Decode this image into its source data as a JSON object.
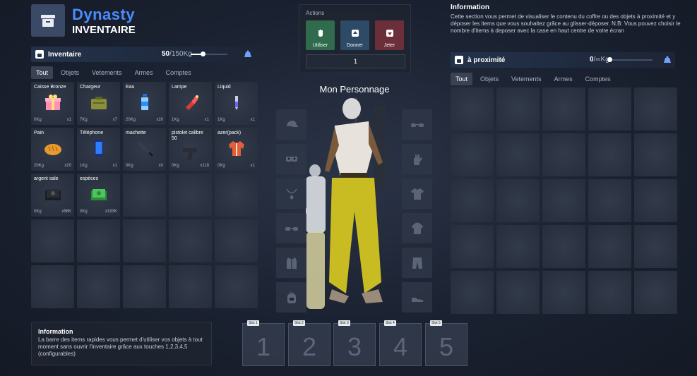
{
  "header": {
    "brand": "Dynasty",
    "subtitle": "INVENTAIRE",
    "logo_icon": "box-icon"
  },
  "inventory": {
    "title": "Inventaire",
    "weight_current": "50",
    "weight_max": "/150Kg",
    "weight_fraction": 0.33,
    "tabs": [
      "Tout",
      "Objets",
      "Vetements",
      "Armes",
      "Comptes"
    ],
    "active_tab": "Tout",
    "items": [
      {
        "name": "Caisse Bronze",
        "weight": "0Kg",
        "qty": "x1",
        "icon": "gift-icon"
      },
      {
        "name": "Chargeur",
        "weight": "7Kg",
        "qty": "x7",
        "icon": "ammo-box-icon"
      },
      {
        "name": "Eau",
        "weight": "20Kg",
        "qty": "x20",
        "icon": "water-bottle-icon"
      },
      {
        "name": "Lampe",
        "weight": "1Kg",
        "qty": "x1",
        "icon": "flashlight-icon"
      },
      {
        "name": "Liquid",
        "weight": "1Kg",
        "qty": "x1",
        "icon": "vial-icon"
      },
      {
        "name": "Pain",
        "weight": "20Kg",
        "qty": "x20",
        "icon": "bread-icon"
      },
      {
        "name": "Téléphone",
        "weight": "1Kg",
        "qty": "x1",
        "icon": "phone-icon"
      },
      {
        "name": "machette",
        "weight": "0Kg",
        "qty": "x0",
        "icon": "machete-icon"
      },
      {
        "name": "pistolet calibre 50",
        "weight": "0Kg",
        "qty": "x118",
        "icon": "pistol-icon"
      },
      {
        "name": "azer(pack)",
        "weight": "0Kg",
        "qty": "x1",
        "icon": "jacket-icon"
      },
      {
        "name": "argent sale",
        "weight": "0Kg",
        "qty": "x56K",
        "icon": "dirty-money-icon"
      },
      {
        "name": "espèces",
        "weight": "0Kg",
        "qty": "x193K",
        "icon": "cash-icon"
      }
    ]
  },
  "actions": {
    "label": "Actions",
    "use": "Utiliser",
    "give": "Donner",
    "drop": "Jeter",
    "quantity": "1"
  },
  "character": {
    "title": "Mon Personnage"
  },
  "equipment_left": [
    "cap-icon",
    "mask-icon",
    "necklace-icon",
    "glasses-icon",
    "vest-icon",
    "bag-icon"
  ],
  "equipment_right": [
    "sunglasses-icon",
    "gloves-icon",
    "tshirt-icon",
    "jacket-icon",
    "pants-icon",
    "shoes-icon"
  ],
  "nearby": {
    "title": "à proximité",
    "weight_current": "0",
    "weight_max": "/∞Kg",
    "tabs": [
      "Tout",
      "Objets",
      "Vetements",
      "Armes",
      "Comptes"
    ],
    "active_tab": "Tout"
  },
  "info_right": {
    "title": "Information",
    "text": "Cette section vous permet de visualiser le contenu du coffre ou des objets à proximité et y déposer les items que vous souhaitez grâce au glisser-déposer. N.B: Vous pouvez choisir le nombre d'items à deposer avec la case en haut centre de votre écran"
  },
  "info_left": {
    "title": "Information",
    "text": "La barre des items rapides vous permet d'utiliser vos objets à tout moment sans ouvrir l'inventaire grâce aux touches 1,2,3,4,5 (configurables)"
  },
  "hotbar": [
    {
      "label": "Slot 1",
      "number": "1"
    },
    {
      "label": "Slot 2",
      "number": "2"
    },
    {
      "label": "Slot 3",
      "number": "3"
    },
    {
      "label": "Slot 4",
      "number": "4"
    },
    {
      "label": "Slot 5",
      "number": "5"
    }
  ],
  "colors": {
    "accent": "#4a8cff",
    "use": "#2f6b4c",
    "give": "#2d4a66",
    "drop": "#6b2f3a"
  }
}
